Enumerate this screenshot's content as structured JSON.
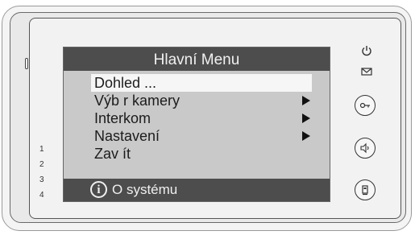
{
  "screen": {
    "title": "Hlavní Menu",
    "menu": [
      {
        "label": "Dohled ...",
        "selected": true,
        "submenu": false
      },
      {
        "label": "Výb r kamery",
        "selected": false,
        "submenu": true
      },
      {
        "label": "Interkom",
        "selected": false,
        "submenu": true
      },
      {
        "label": "Nastavení",
        "selected": false,
        "submenu": true
      },
      {
        "label": "Zav ít",
        "selected": false,
        "submenu": false
      }
    ],
    "status_text": "O systému",
    "info_glyph": "i"
  },
  "side_numbers": [
    "1",
    "2",
    "3",
    "4"
  ],
  "side_buttons": [
    {
      "name": "power-icon",
      "label": "power"
    },
    {
      "name": "mail-icon",
      "label": "messages"
    },
    {
      "name": "key-icon",
      "label": "unlock"
    },
    {
      "name": "speaker-icon",
      "label": "talk"
    },
    {
      "name": "menu-card-icon",
      "label": "menu"
    }
  ],
  "colors": {
    "screen_background": "#c9c9c9",
    "bar_background": "#4d4d4d",
    "bar_text": "#f0f0f0",
    "selection": "#f6f6f6"
  }
}
